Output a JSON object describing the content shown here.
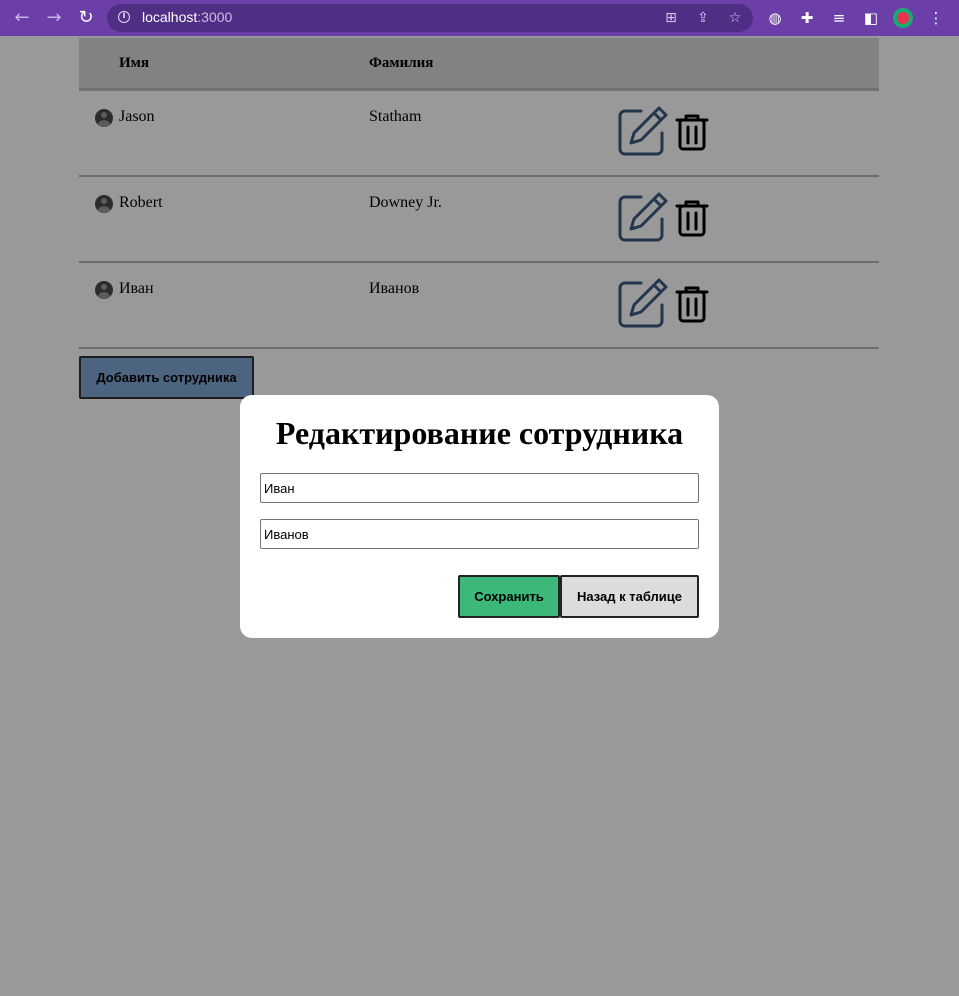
{
  "browser": {
    "url_host": "localhost",
    "url_port": ":3000"
  },
  "table": {
    "headers": [
      "Имя",
      "Фамилия"
    ],
    "rows": [
      {
        "first_name": "Jason",
        "last_name": "Statham"
      },
      {
        "first_name": "Robert",
        "last_name": "Downey Jr."
      },
      {
        "first_name": "Иван",
        "last_name": "Иванов"
      }
    ],
    "edit_icon_color": "#3d5a80"
  },
  "add_button": {
    "label": "Добавить сотрудника",
    "color": "#7fa7d6"
  },
  "modal": {
    "title": "Редактирование сотрудника",
    "first_name_value": "Иван",
    "last_name_value": "Иванов",
    "save_label": "Сохранить",
    "back_label": "Назад к таблице",
    "save_color": "#3cb87a",
    "back_color": "#dcdcdc"
  }
}
